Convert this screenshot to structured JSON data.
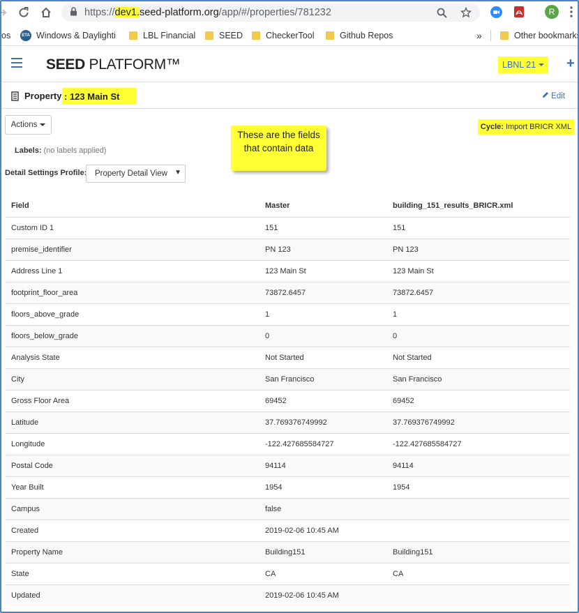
{
  "browser": {
    "url_scheme": "https://",
    "url_highlight": "dev1.",
    "url_host": "seed-platform.org",
    "url_path": "/app/#/properties/781232",
    "profile_initial": "R",
    "colors": {
      "highlight": "#ffff33",
      "profile": "#5aa646"
    }
  },
  "bookmarks": {
    "items": [
      {
        "label": "os",
        "icon": ""
      },
      {
        "label": "Windows & Daylighti",
        "icon": "eta-icon"
      },
      {
        "label": "LBL Financial",
        "icon": "folder-icon"
      },
      {
        "label": "SEED",
        "icon": "folder-icon"
      },
      {
        "label": "CheckerTool",
        "icon": "folder-icon"
      },
      {
        "label": "Github Repos",
        "icon": "folder-icon"
      }
    ],
    "overflow": "»",
    "other": "Other bookmarks",
    "eta_badge": "ETA"
  },
  "app": {
    "brand_bold": "SEED",
    "brand_rest": " PLATFORM™",
    "org": "LBNL 21",
    "accent": "#3d6fb3"
  },
  "property": {
    "label": "Property",
    "name": ": 123 Main St",
    "edit": "Edit"
  },
  "controls": {
    "actions": "Actions",
    "callout": "These are the fields that contain data",
    "cycle_label": "Cycle:",
    "cycle_value": "Import BRICR XML",
    "labels_label": "Labels:",
    "labels_value": "(no labels applied)",
    "profile_label": "Detail Settings Profile:",
    "profile_value": "Property Detail View"
  },
  "table": {
    "headers": [
      "Field",
      "Master",
      "building_151_results_BRICR.xml"
    ],
    "rows": [
      [
        "Custom ID 1",
        "151",
        "151"
      ],
      [
        "premise_identifier",
        "PN 123",
        "PN 123"
      ],
      [
        "Address Line 1",
        "123 Main St",
        "123 Main St"
      ],
      [
        "footprint_floor_area",
        "73872.6457",
        "73872.6457"
      ],
      [
        "floors_above_grade",
        "1",
        "1"
      ],
      [
        "floors_below_grade",
        "0",
        "0"
      ],
      [
        "Analysis State",
        "Not Started",
        "Not Started"
      ],
      [
        "City",
        "San Francisco",
        "San Francisco"
      ],
      [
        "Gross Floor Area",
        "69452",
        "69452"
      ],
      [
        "Latitude",
        "37.769376749992",
        "37.769376749992"
      ],
      [
        "Longitude",
        "-122.427685584727",
        "-122.427685584727"
      ],
      [
        "Postal Code",
        "94114",
        "94114"
      ],
      [
        "Year Built",
        "1954",
        "1954"
      ],
      [
        "Campus",
        "false",
        ""
      ],
      [
        "Created",
        "2019-02-06 10:45 AM",
        ""
      ],
      [
        "Property Name",
        "Building151",
        "Building151"
      ],
      [
        "State",
        "CA",
        "CA"
      ],
      [
        "Updated",
        "2019-02-06 10:45 AM",
        ""
      ]
    ]
  }
}
